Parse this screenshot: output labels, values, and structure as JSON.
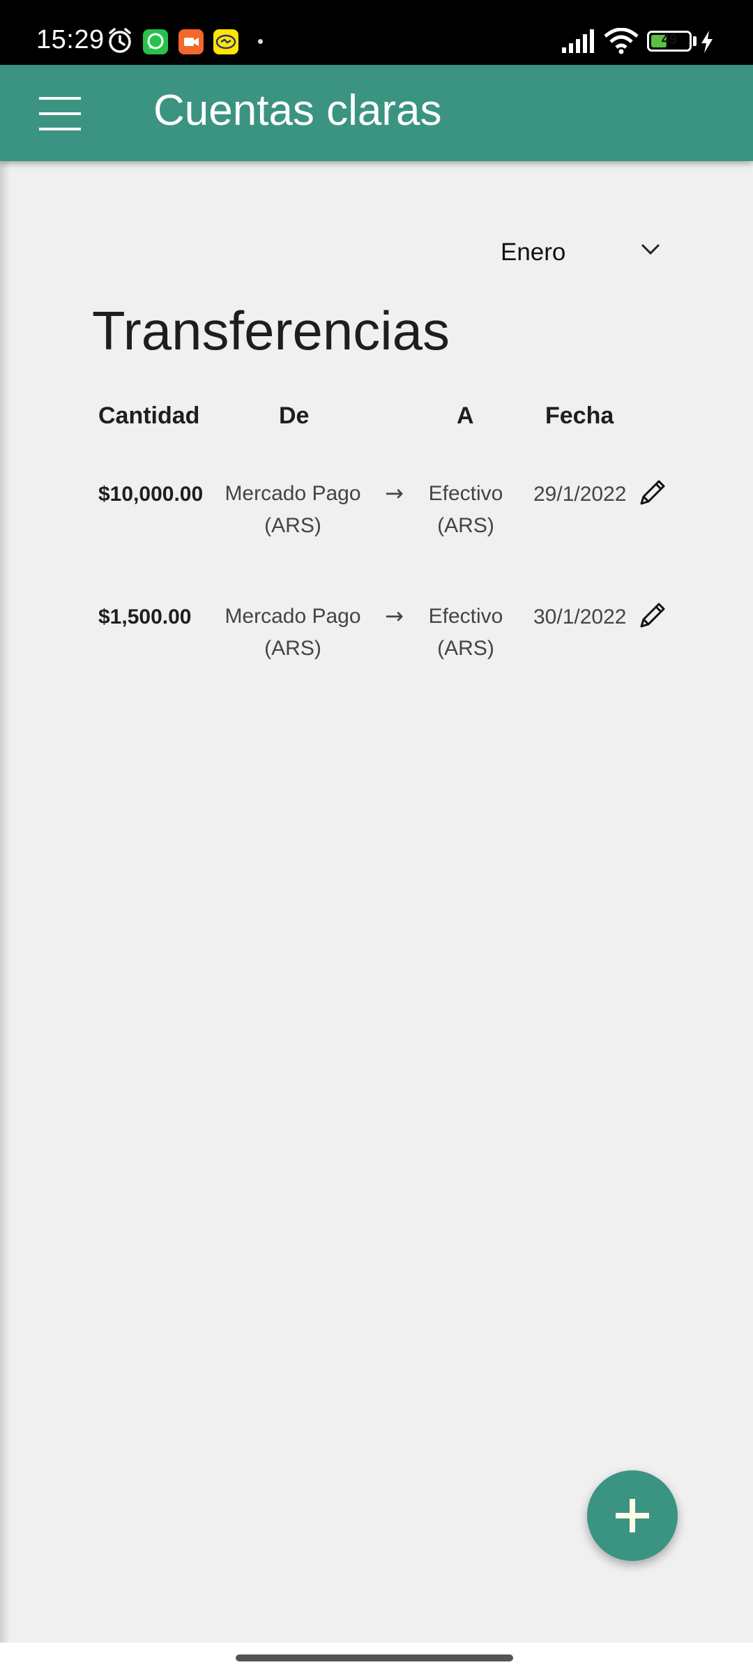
{
  "status_bar": {
    "time": "15:29",
    "battery_level": "49",
    "battery_fraction": 0.49,
    "icons": [
      "alarm-icon",
      "whatsapp-icon",
      "video-call-icon",
      "mercado-libre-icon",
      "notification-dot",
      "signal-icon",
      "wifi-icon",
      "battery-icon",
      "charging-icon"
    ]
  },
  "app_bar": {
    "title": "Cuentas claras",
    "menu_icon": "hamburger-menu-icon",
    "color": "#3a9481"
  },
  "filter": {
    "month": "Enero",
    "icon": "chevron-down-icon"
  },
  "page": {
    "title": "Transferencias"
  },
  "table": {
    "headers": {
      "amount": "Cantidad",
      "from": "De",
      "to": "A",
      "date": "Fecha"
    },
    "rows": [
      {
        "amount": "$10,000.00",
        "from_line1": "Mercado Pago",
        "from_line2": "(ARS)",
        "arrow": "→",
        "to_line1": "Efectivo",
        "to_line2": "(ARS)",
        "date": "29/1/2022",
        "edit_icon": "pencil-icon"
      },
      {
        "amount": "$1,500.00",
        "from_line1": "Mercado Pago",
        "from_line2": "(ARS)",
        "arrow": "→",
        "to_line1": "Efectivo",
        "to_line2": "(ARS)",
        "date": "30/1/2022",
        "edit_icon": "pencil-icon"
      }
    ]
  },
  "fab": {
    "icon": "plus-icon",
    "color": "#3a9481",
    "icon_color": "#fffbe6"
  }
}
